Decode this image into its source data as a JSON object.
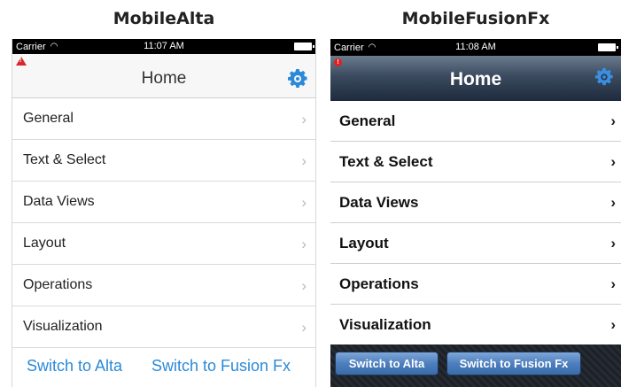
{
  "panels": {
    "alta": {
      "heading": "MobileAlta",
      "status": {
        "carrier": "Carrier",
        "time": "11:07 AM"
      },
      "nav": {
        "title": "Home"
      },
      "items": [
        {
          "label": "General"
        },
        {
          "label": "Text & Select"
        },
        {
          "label": "Data Views"
        },
        {
          "label": "Layout"
        },
        {
          "label": "Operations"
        },
        {
          "label": "Visualization"
        }
      ],
      "footer": {
        "switch_alta": "Switch to Alta",
        "switch_fusion": "Switch to Fusion Fx"
      },
      "colors": {
        "accent": "#2a8ad8",
        "warning": "#d7272f"
      }
    },
    "fusion": {
      "heading": "MobileFusionFx",
      "status": {
        "carrier": "Carrier",
        "time": "11:08 AM"
      },
      "nav": {
        "title": "Home"
      },
      "items": [
        {
          "label": "General"
        },
        {
          "label": "Text & Select"
        },
        {
          "label": "Data Views"
        },
        {
          "label": "Layout"
        },
        {
          "label": "Operations"
        },
        {
          "label": "Visualization"
        }
      ],
      "footer": {
        "switch_alta": "Switch to Alta",
        "switch_fusion": "Switch to Fusion Fx"
      },
      "colors": {
        "nav_bar": "#2f3d52",
        "button": "#4d7fbf",
        "error": "#e02020"
      }
    }
  },
  "icons": {
    "chevron": "chevron-right-icon",
    "settings": "gear-icon",
    "wifi": "wifi-icon",
    "battery": "battery-icon"
  }
}
